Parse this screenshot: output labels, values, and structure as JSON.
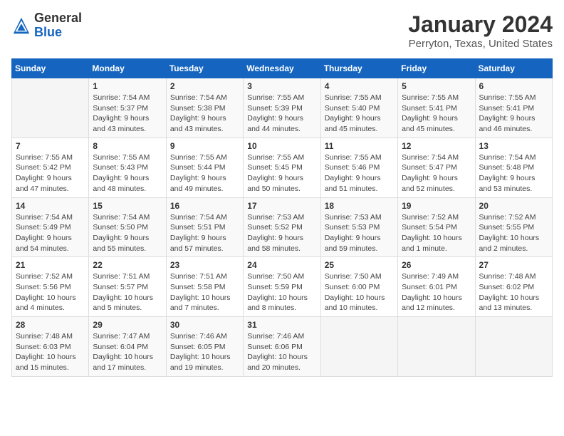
{
  "header": {
    "logo_general": "General",
    "logo_blue": "Blue",
    "title": "January 2024",
    "subtitle": "Perryton, Texas, United States"
  },
  "weekdays": [
    "Sunday",
    "Monday",
    "Tuesday",
    "Wednesday",
    "Thursday",
    "Friday",
    "Saturday"
  ],
  "weeks": [
    [
      {
        "day": "",
        "sunrise": "",
        "sunset": "",
        "daylight": ""
      },
      {
        "day": "1",
        "sunrise": "Sunrise: 7:54 AM",
        "sunset": "Sunset: 5:37 PM",
        "daylight": "Daylight: 9 hours and 43 minutes."
      },
      {
        "day": "2",
        "sunrise": "Sunrise: 7:54 AM",
        "sunset": "Sunset: 5:38 PM",
        "daylight": "Daylight: 9 hours and 43 minutes."
      },
      {
        "day": "3",
        "sunrise": "Sunrise: 7:55 AM",
        "sunset": "Sunset: 5:39 PM",
        "daylight": "Daylight: 9 hours and 44 minutes."
      },
      {
        "day": "4",
        "sunrise": "Sunrise: 7:55 AM",
        "sunset": "Sunset: 5:40 PM",
        "daylight": "Daylight: 9 hours and 45 minutes."
      },
      {
        "day": "5",
        "sunrise": "Sunrise: 7:55 AM",
        "sunset": "Sunset: 5:41 PM",
        "daylight": "Daylight: 9 hours and 45 minutes."
      },
      {
        "day": "6",
        "sunrise": "Sunrise: 7:55 AM",
        "sunset": "Sunset: 5:41 PM",
        "daylight": "Daylight: 9 hours and 46 minutes."
      }
    ],
    [
      {
        "day": "7",
        "sunrise": "Sunrise: 7:55 AM",
        "sunset": "Sunset: 5:42 PM",
        "daylight": "Daylight: 9 hours and 47 minutes."
      },
      {
        "day": "8",
        "sunrise": "Sunrise: 7:55 AM",
        "sunset": "Sunset: 5:43 PM",
        "daylight": "Daylight: 9 hours and 48 minutes."
      },
      {
        "day": "9",
        "sunrise": "Sunrise: 7:55 AM",
        "sunset": "Sunset: 5:44 PM",
        "daylight": "Daylight: 9 hours and 49 minutes."
      },
      {
        "day": "10",
        "sunrise": "Sunrise: 7:55 AM",
        "sunset": "Sunset: 5:45 PM",
        "daylight": "Daylight: 9 hours and 50 minutes."
      },
      {
        "day": "11",
        "sunrise": "Sunrise: 7:55 AM",
        "sunset": "Sunset: 5:46 PM",
        "daylight": "Daylight: 9 hours and 51 minutes."
      },
      {
        "day": "12",
        "sunrise": "Sunrise: 7:54 AM",
        "sunset": "Sunset: 5:47 PM",
        "daylight": "Daylight: 9 hours and 52 minutes."
      },
      {
        "day": "13",
        "sunrise": "Sunrise: 7:54 AM",
        "sunset": "Sunset: 5:48 PM",
        "daylight": "Daylight: 9 hours and 53 minutes."
      }
    ],
    [
      {
        "day": "14",
        "sunrise": "Sunrise: 7:54 AM",
        "sunset": "Sunset: 5:49 PM",
        "daylight": "Daylight: 9 hours and 54 minutes."
      },
      {
        "day": "15",
        "sunrise": "Sunrise: 7:54 AM",
        "sunset": "Sunset: 5:50 PM",
        "daylight": "Daylight: 9 hours and 55 minutes."
      },
      {
        "day": "16",
        "sunrise": "Sunrise: 7:54 AM",
        "sunset": "Sunset: 5:51 PM",
        "daylight": "Daylight: 9 hours and 57 minutes."
      },
      {
        "day": "17",
        "sunrise": "Sunrise: 7:53 AM",
        "sunset": "Sunset: 5:52 PM",
        "daylight": "Daylight: 9 hours and 58 minutes."
      },
      {
        "day": "18",
        "sunrise": "Sunrise: 7:53 AM",
        "sunset": "Sunset: 5:53 PM",
        "daylight": "Daylight: 9 hours and 59 minutes."
      },
      {
        "day": "19",
        "sunrise": "Sunrise: 7:52 AM",
        "sunset": "Sunset: 5:54 PM",
        "daylight": "Daylight: 10 hours and 1 minute."
      },
      {
        "day": "20",
        "sunrise": "Sunrise: 7:52 AM",
        "sunset": "Sunset: 5:55 PM",
        "daylight": "Daylight: 10 hours and 2 minutes."
      }
    ],
    [
      {
        "day": "21",
        "sunrise": "Sunrise: 7:52 AM",
        "sunset": "Sunset: 5:56 PM",
        "daylight": "Daylight: 10 hours and 4 minutes."
      },
      {
        "day": "22",
        "sunrise": "Sunrise: 7:51 AM",
        "sunset": "Sunset: 5:57 PM",
        "daylight": "Daylight: 10 hours and 5 minutes."
      },
      {
        "day": "23",
        "sunrise": "Sunrise: 7:51 AM",
        "sunset": "Sunset: 5:58 PM",
        "daylight": "Daylight: 10 hours and 7 minutes."
      },
      {
        "day": "24",
        "sunrise": "Sunrise: 7:50 AM",
        "sunset": "Sunset: 5:59 PM",
        "daylight": "Daylight: 10 hours and 8 minutes."
      },
      {
        "day": "25",
        "sunrise": "Sunrise: 7:50 AM",
        "sunset": "Sunset: 6:00 PM",
        "daylight": "Daylight: 10 hours and 10 minutes."
      },
      {
        "day": "26",
        "sunrise": "Sunrise: 7:49 AM",
        "sunset": "Sunset: 6:01 PM",
        "daylight": "Daylight: 10 hours and 12 minutes."
      },
      {
        "day": "27",
        "sunrise": "Sunrise: 7:48 AM",
        "sunset": "Sunset: 6:02 PM",
        "daylight": "Daylight: 10 hours and 13 minutes."
      }
    ],
    [
      {
        "day": "28",
        "sunrise": "Sunrise: 7:48 AM",
        "sunset": "Sunset: 6:03 PM",
        "daylight": "Daylight: 10 hours and 15 minutes."
      },
      {
        "day": "29",
        "sunrise": "Sunrise: 7:47 AM",
        "sunset": "Sunset: 6:04 PM",
        "daylight": "Daylight: 10 hours and 17 minutes."
      },
      {
        "day": "30",
        "sunrise": "Sunrise: 7:46 AM",
        "sunset": "Sunset: 6:05 PM",
        "daylight": "Daylight: 10 hours and 19 minutes."
      },
      {
        "day": "31",
        "sunrise": "Sunrise: 7:46 AM",
        "sunset": "Sunset: 6:06 PM",
        "daylight": "Daylight: 10 hours and 20 minutes."
      },
      {
        "day": "",
        "sunrise": "",
        "sunset": "",
        "daylight": ""
      },
      {
        "day": "",
        "sunrise": "",
        "sunset": "",
        "daylight": ""
      },
      {
        "day": "",
        "sunrise": "",
        "sunset": "",
        "daylight": ""
      }
    ]
  ]
}
